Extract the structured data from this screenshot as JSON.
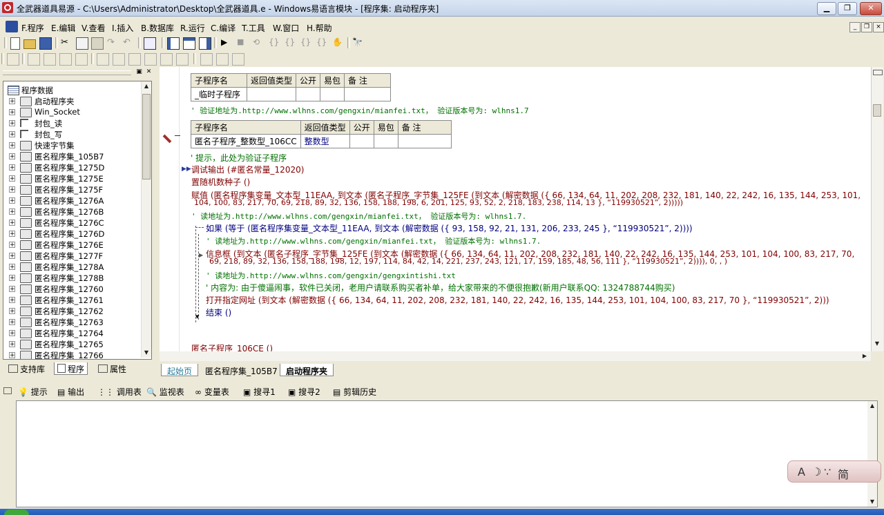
{
  "window": {
    "title": "全武器道具易源 - C:\\Users\\Administrator\\Desktop\\全武器道具.e - Windows易语言模块 - [程序集: 启动程序夹]",
    "controls": [
      "▁",
      "❐",
      "✕"
    ]
  },
  "menu": {
    "items": [
      "F.程序",
      "E.编辑",
      "V.查看",
      "I.插入",
      "B.数据库",
      "R.运行",
      "C.编译",
      "T.工具",
      "W.窗口",
      "H.帮助"
    ],
    "mdi_controls": [
      "_",
      "❐",
      "×"
    ]
  },
  "toolbar": {
    "row1_icons": [
      "new-file-icon",
      "open-folder-icon",
      "save-icon",
      "cut-icon",
      "copy-icon",
      "paste-icon",
      "redo-icon",
      "undo-icon",
      "find-icon",
      "layout-1-icon",
      "layout-2-icon",
      "layout-3-icon",
      "run-icon",
      "stop-icon",
      "step-1-icon",
      "step-2-icon",
      "step-3-icon",
      "step-4-icon",
      "step-5-icon",
      "hand-icon",
      "binoculars-icon"
    ],
    "row2_icons": [
      "align-1-icon",
      "align-2-icon",
      "align-3-icon",
      "align-4-icon",
      "align-5-icon",
      "align-6-icon",
      "align-7-icon",
      "align-8-icon",
      "align-9-icon",
      "align-10-icon",
      "align-11-icon",
      "align-12-icon"
    ]
  },
  "left_panel": {
    "root": "程序数据",
    "items": [
      {
        "label": "启动程序夹",
        "icon": "stack"
      },
      {
        "label": "Win_Socket",
        "icon": "stack"
      },
      {
        "label": "封包_读",
        "icon": "tree"
      },
      {
        "label": "封包_写",
        "icon": "tree"
      },
      {
        "label": "快速字节集",
        "icon": "stack"
      },
      {
        "label": "匿名程序集_105B7",
        "icon": "stack"
      },
      {
        "label": "匿名程序集_1275D",
        "icon": "stack"
      },
      {
        "label": "匿名程序集_1275E",
        "icon": "stack"
      },
      {
        "label": "匿名程序集_1275F",
        "icon": "stack"
      },
      {
        "label": "匿名程序集_1276A",
        "icon": "stack"
      },
      {
        "label": "匿名程序集_1276B",
        "icon": "stack"
      },
      {
        "label": "匿名程序集_1276C",
        "icon": "stack"
      },
      {
        "label": "匿名程序集_1276D",
        "icon": "stack"
      },
      {
        "label": "匿名程序集_1276E",
        "icon": "stack"
      },
      {
        "label": "匿名程序集_1277F",
        "icon": "stack"
      },
      {
        "label": "匿名程序集_1278A",
        "icon": "stack"
      },
      {
        "label": "匿名程序集_1278B",
        "icon": "stack"
      },
      {
        "label": "匿名程序集_12760",
        "icon": "stack"
      },
      {
        "label": "匿名程序集_12761",
        "icon": "stack"
      },
      {
        "label": "匿名程序集_12762",
        "icon": "stack"
      },
      {
        "label": "匿名程序集_12763",
        "icon": "stack"
      },
      {
        "label": "匿名程序集_12764",
        "icon": "stack"
      },
      {
        "label": "匿名程序集_12765",
        "icon": "stack"
      },
      {
        "label": "匿名程序集_12766",
        "icon": "stack"
      }
    ],
    "tabs": [
      "支持库",
      "程序",
      "属性"
    ]
  },
  "editor": {
    "table1": {
      "headers": [
        "子程序名",
        "返回值类型",
        "公开",
        "易包",
        "备 注"
      ],
      "row": [
        "_临时子程序",
        "",
        "",
        "",
        ""
      ]
    },
    "comment1": "' 验证地址为.http://www.wlhns.com/gengxin/mianfei.txt， 验证版本号为: wlhns1.7",
    "table2": {
      "headers": [
        "子程序名",
        "返回值类型",
        "公开",
        "易包",
        "备 注"
      ],
      "row": [
        "匿名子程序_整数型_106CC",
        "整数型",
        "",
        "",
        ""
      ]
    },
    "line_hint": "' 提示，此处为验证子程序",
    "line_debug": "调试输出 (#匿名常量_12020)",
    "line_seed": "置随机数种子 ()",
    "line_assign1": "赋值 (匿名程序集变量_文本型_11EAA, 到文本 (匿名子程序_字节集_125FE (到文本 (解密数据 ({ 66, 134, 64, 11, 202, 208, 232, 181, 140, 22, 242, 16, 135, 144, 253, 101,",
    "line_assign2": "104, 100, 83, 217, 70, 69, 218, 89, 32, 136, 158, 188, 198, 6, 201, 125, 93, 52, 2, 218, 183, 238, 114, 13 }, “119930521”, 2)))))",
    "comment2": "' 读地址为.http://www.wlhns.com/gengxin/mianfei.txt， 验证版本号为: wlhns1.7.",
    "line_if": "如果 (等于 (匿名程序集变量_文本型_11EAA, 到文本 (解密数据 ({ 93, 158, 92, 21, 131, 206, 233, 245 }, “119930521”, 2))))",
    "comment3": "' 读地址为.http://www.wlhns.com/gengxin/mianfei.txt， 验证版本号为: wlhns1.7.",
    "line_msg1": "信息框 (到文本 (匿名子程序_字节集_125FE (到文本 (解密数据 ({ 66, 134, 64, 11, 202, 208, 232, 181, 140, 22, 242, 16, 135, 144, 253, 101, 104, 100, 83, 217, 70,",
    "line_msg2": "69, 218, 89, 32, 136, 158, 188, 198, 12, 197, 114, 84, 42, 14, 221, 237, 243, 121, 17, 159, 185, 48, 56, 111 }, “119930521”, 2)))), 0, , )",
    "comment4": "' 读地址为.http://www.wlhns.com/gengxin/gengxintishi.txt",
    "comment5": "' 内容为: 由于傻逼闹事，软件已关闭，老用户请联系购买者补单，给大家带来的不便很抱歉(新用户联系QQ: 1324788744购买)",
    "line_open": "打开指定网址 (到文本 (解密数据 ({ 66, 134, 64, 11, 202, 208, 232, 181, 140, 22, 242, 16, 135, 144, 253, 101, 104, 100, 83, 217, 70 }, “119930521”, 2)))",
    "line_end": "结束 ()",
    "line_bottom": "匿名子程序_106CE ()"
  },
  "doc_tabs": [
    "起始页",
    "匿名程序集_105B7",
    "启动程序夹"
  ],
  "output_tabs": [
    "提示",
    "输出",
    "调用表",
    "监视表",
    "变量表",
    "搜寻1",
    "搜寻2",
    "剪辑历史"
  ],
  "ime": {
    "items": [
      "A",
      "☽",
      "∵",
      "简"
    ]
  }
}
